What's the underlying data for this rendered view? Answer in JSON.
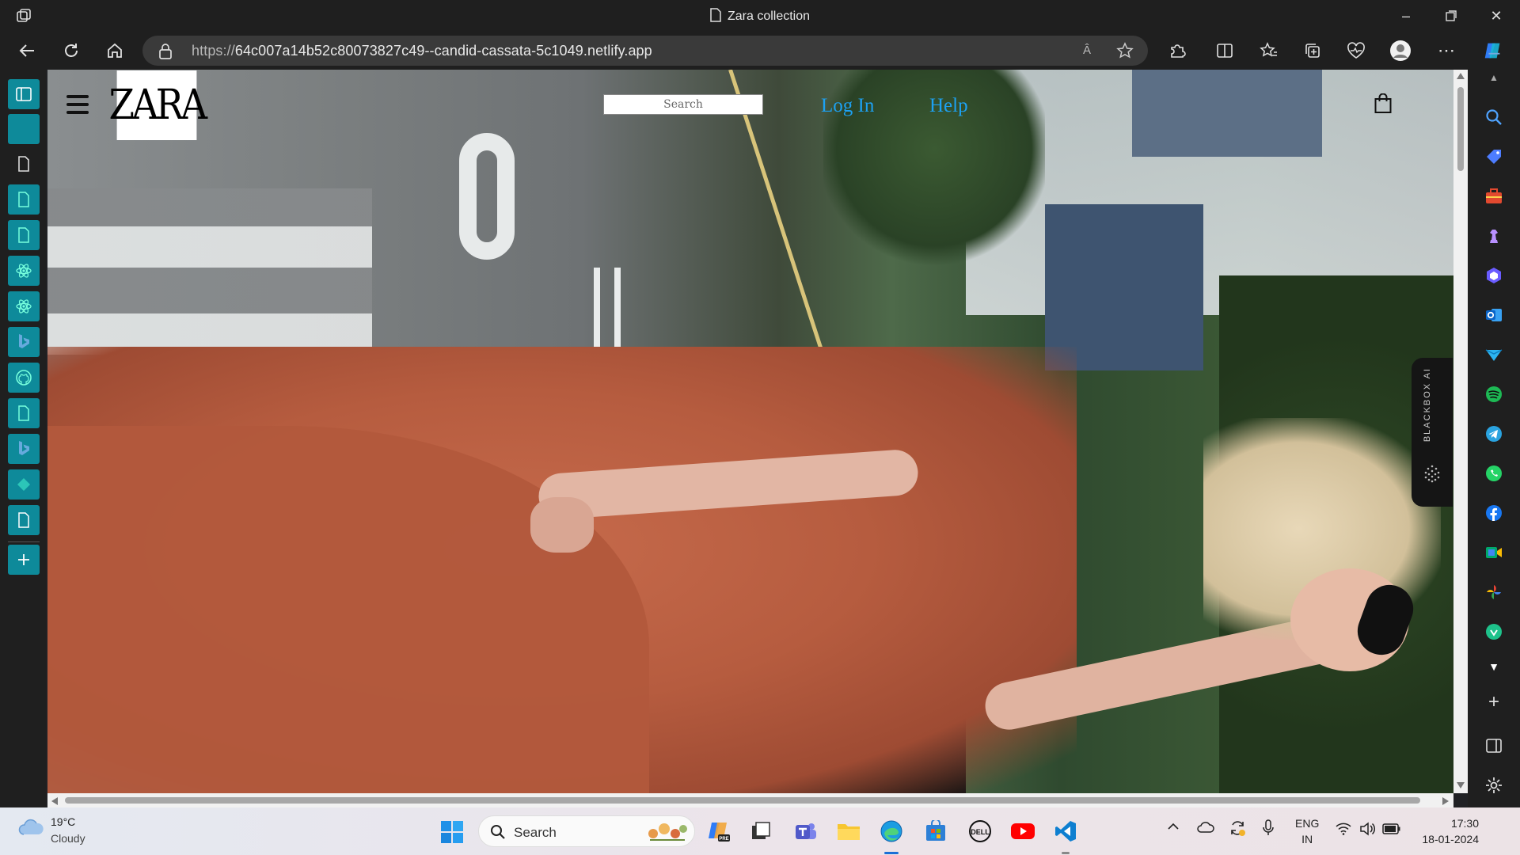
{
  "browser": {
    "tab_title": "Zara collection",
    "url_prefix": "https://",
    "url_main": "64c007a14b52c80073827c49--candid-cassata-5c1049.netlify.app",
    "read_aloud": "Â"
  },
  "site": {
    "logo_text": "ZARA",
    "search_placeholder": "Search",
    "login_label": "Log In",
    "help_label": "Help",
    "link_color": "#1da1f2"
  },
  "extension": {
    "blackbox_label": "BLACKBOX AI"
  },
  "taskbar": {
    "temperature": "19°C",
    "condition": "Cloudy",
    "search_label": "Search",
    "lang_top": "ENG",
    "lang_bottom": "IN",
    "time": "17:30",
    "date": "18-01-2024"
  },
  "colors": {
    "tab_accent": "#0e8a9a",
    "copilot": "#2f7cf6"
  }
}
